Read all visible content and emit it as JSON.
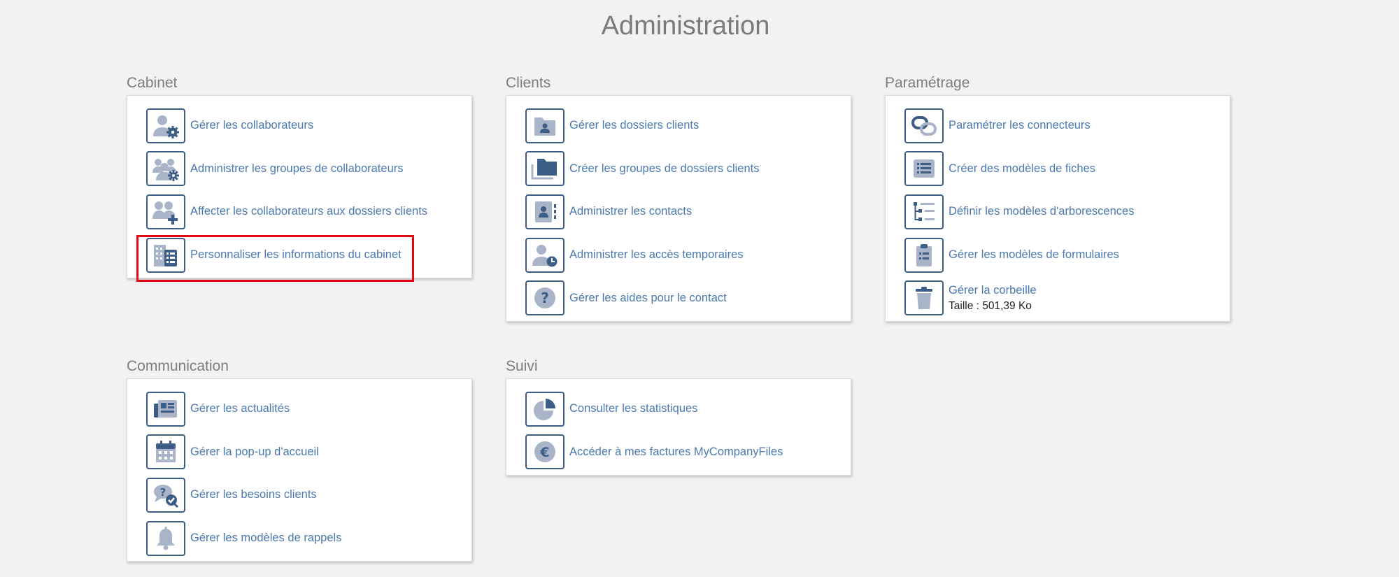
{
  "page": {
    "title": "Administration"
  },
  "sections": {
    "cabinet": {
      "title": "Cabinet",
      "items": [
        {
          "label": "Gérer les collaborateurs",
          "icon": "user-gear-icon"
        },
        {
          "label": "Administrer les groupes de collaborateurs",
          "icon": "users-gear-icon"
        },
        {
          "label": "Affecter les collaborateurs aux dossiers clients",
          "icon": "users-plus-icon"
        },
        {
          "label": "Personnaliser les informations du cabinet",
          "icon": "building-list-icon"
        }
      ]
    },
    "clients": {
      "title": "Clients",
      "items": [
        {
          "label": "Gérer les dossiers clients",
          "icon": "folder-user-icon"
        },
        {
          "label": "Créer les groupes de dossiers clients",
          "icon": "folders-icon"
        },
        {
          "label": "Administrer les contacts",
          "icon": "contact-card-icon"
        },
        {
          "label": "Administrer les accès temporaires",
          "icon": "user-clock-icon"
        },
        {
          "label": "Gérer les aides pour le contact",
          "icon": "question-circle-icon"
        }
      ]
    },
    "parametrage": {
      "title": "Paramétrage",
      "items": [
        {
          "label": "Paramétrer les connecteurs",
          "icon": "link-icon"
        },
        {
          "label": "Créer des modèles de fiches",
          "icon": "list-card-icon"
        },
        {
          "label": "Définir les modèles d'arborescences",
          "icon": "tree-list-icon"
        },
        {
          "label": "Gérer les modèles de formulaires",
          "icon": "clipboard-icon"
        },
        {
          "label": "Gérer la corbeille",
          "sub": "Taille : 501,39 Ko",
          "icon": "trash-icon"
        }
      ]
    },
    "communication": {
      "title": "Communication",
      "items": [
        {
          "label": "Gérer les actualités",
          "icon": "newspaper-icon"
        },
        {
          "label": "Gérer la pop-up d'accueil",
          "icon": "calendar-icon"
        },
        {
          "label": "Gérer les besoins clients",
          "icon": "chat-question-icon"
        },
        {
          "label": "Gérer les modèles de rappels",
          "icon": "bell-icon"
        }
      ]
    },
    "suivi": {
      "title": "Suivi",
      "items": [
        {
          "label": "Consulter les statistiques",
          "icon": "pie-chart-icon"
        },
        {
          "label": "Accéder à mes factures MyCompanyFiles",
          "icon": "euro-icon"
        }
      ]
    }
  },
  "colors": {
    "background": "#f2f2f2",
    "link": "#4a79ad",
    "icon_dark": "#3b5d86",
    "icon_light": "#a9b4c8",
    "highlight": "#e30613"
  }
}
